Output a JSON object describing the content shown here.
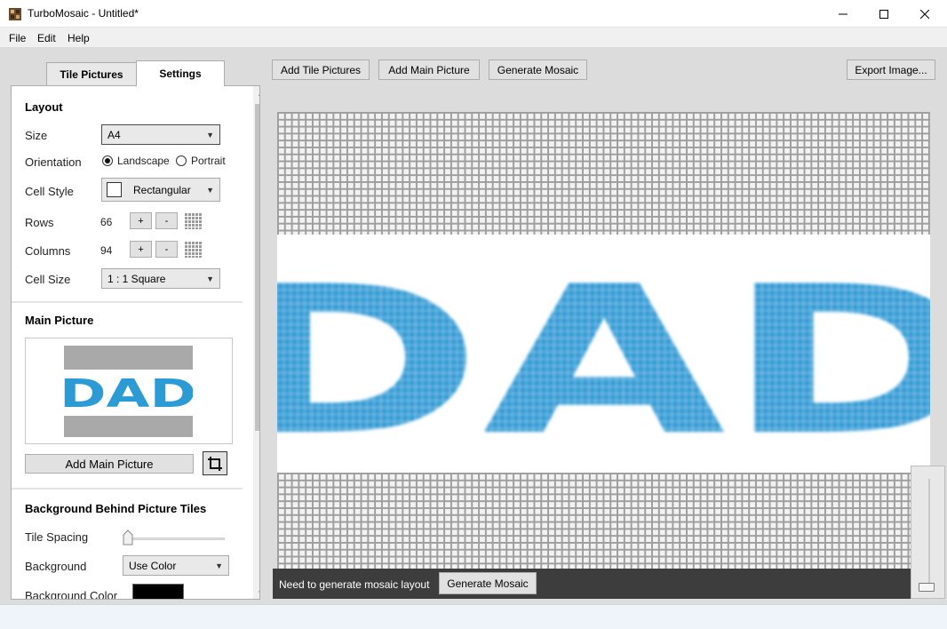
{
  "window": {
    "title": "TurboMosaic - Untitled*"
  },
  "menu": [
    "File",
    "Edit",
    "Help"
  ],
  "tabs": {
    "tile_pictures": "Tile Pictures",
    "settings": "Settings"
  },
  "toolbar": {
    "add_tile_pictures": "Add Tile Pictures",
    "add_main_picture": "Add Main Picture",
    "generate_mosaic": "Generate Mosaic",
    "export_image": "Export Image..."
  },
  "layout": {
    "title": "Layout",
    "size_label": "Size",
    "size_value": "A4",
    "orientation_label": "Orientation",
    "orientation_landscape": "Landscape",
    "orientation_portrait": "Portrait",
    "cell_style_label": "Cell Style",
    "cell_style_value": "Rectangular",
    "rows_label": "Rows",
    "rows_value": "66",
    "columns_label": "Columns",
    "columns_value": "94",
    "plus": "+",
    "minus": "-",
    "cell_size_label": "Cell Size",
    "cell_size_value": "1 : 1 Square"
  },
  "main_picture": {
    "title": "Main Picture",
    "preview_text": "DAD",
    "add_button": "Add Main Picture"
  },
  "background": {
    "title": "Background Behind Picture Tiles",
    "tile_spacing_label": "Tile Spacing",
    "tile_spacing_value": 0,
    "background_label": "Background",
    "background_value": "Use Color",
    "background_color_label": "Background Color",
    "background_color": "#000000"
  },
  "canvas": {
    "mosaic_text": "DAD",
    "accent": "#2a9bd5",
    "zoom_level": 0
  },
  "banner": {
    "message": "Need to generate mosaic layout",
    "button": "Generate Mosaic"
  }
}
